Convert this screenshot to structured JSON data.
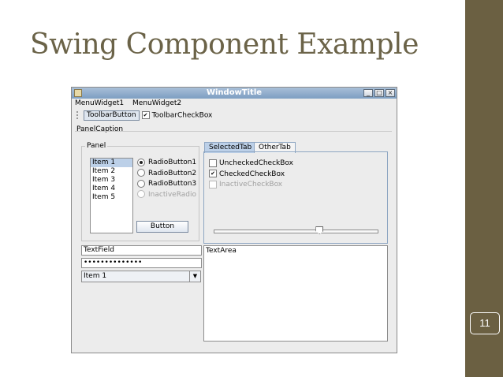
{
  "slide": {
    "title": "Swing Component Example",
    "page_number": "11",
    "colors": {
      "title": "#6b6348",
      "sidebar": "#6b6042"
    }
  },
  "window": {
    "title": "WindowTitle",
    "controls": {
      "minimize": "_",
      "maximize": "□",
      "close": "×"
    },
    "menus": [
      "MenuWidget1",
      "MenuWidget2"
    ],
    "toolbar": {
      "button_label": "ToolbarButton",
      "checkbox_label": "ToolbarCheckBox",
      "checkbox_checked": true
    },
    "panel_caption": "PanelCaption",
    "panel": {
      "label": "Panel",
      "list_items": [
        "Item 1",
        "Item 2",
        "Item 3",
        "Item 4",
        "Item 5"
      ],
      "selected_index": 0,
      "radios": [
        {
          "label": "RadioButton1",
          "selected": true,
          "enabled": true
        },
        {
          "label": "RadioButton2",
          "selected": false,
          "enabled": true
        },
        {
          "label": "RadioButton3",
          "selected": false,
          "enabled": true
        },
        {
          "label": "InactiveRadio",
          "selected": false,
          "enabled": false
        }
      ],
      "button_label": "Button"
    },
    "tabs": [
      {
        "label": "SelectedTab",
        "active": true
      },
      {
        "label": "OtherTab",
        "active": false
      }
    ],
    "checkboxes": [
      {
        "label": "UncheckedCheckBox",
        "checked": false,
        "enabled": true
      },
      {
        "label": "CheckedCheckBox",
        "checked": true,
        "enabled": true
      },
      {
        "label": "InactiveCheckBox",
        "checked": false,
        "enabled": false
      }
    ],
    "slider_value_pct": 65,
    "text_field": "TextField",
    "password": "••••••••••••••",
    "combo_value": "Item 1",
    "text_area": "TextArea"
  }
}
